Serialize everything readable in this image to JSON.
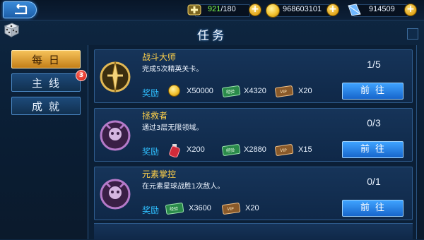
{
  "header": {
    "stamina": {
      "current": "921",
      "max": "/180",
      "icon": "stamina-plus-icon"
    },
    "gold": {
      "value": "968603101",
      "icon": "gold-coin-icon"
    },
    "diamond": {
      "value": "914509",
      "icon": "blue-crystal-icon"
    },
    "plus": "+"
  },
  "title": "任务",
  "tabs": [
    {
      "label": "每日",
      "active": true
    },
    {
      "label": "主线",
      "badge": "3"
    },
    {
      "label": "成就"
    }
  ],
  "tasks": [
    {
      "name": "战斗大师",
      "desc": "完成5次精英关卡。",
      "progress": "1/5",
      "reward_label": "奖励",
      "rewards": [
        {
          "icon": "gold-coin-icon",
          "qty": "X50000"
        },
        {
          "icon": "exp-ticket-icon",
          "qty": "X4320"
        },
        {
          "icon": "vip-ticket-icon",
          "qty": "X20"
        }
      ],
      "button": "前往",
      "emblem_color": "#c49a3a"
    },
    {
      "name": "拯救者",
      "desc": "通过3层无限领域。",
      "progress": "0/3",
      "reward_label": "奖励",
      "rewards": [
        {
          "icon": "red-potion-icon",
          "qty": "X200"
        },
        {
          "icon": "exp-ticket-icon",
          "qty": "X2880"
        },
        {
          "icon": "vip-ticket-icon",
          "qty": "X15"
        }
      ],
      "button": "前往",
      "emblem_color": "#8e4a9e"
    },
    {
      "name": "元素掌控",
      "desc": "在元素星球战胜1次敌人。",
      "progress": "0/1",
      "reward_label": "奖励",
      "rewards": [
        {
          "icon": "exp-ticket-icon",
          "qty": "X3600"
        },
        {
          "icon": "vip-ticket-icon",
          "qty": "X20"
        }
      ],
      "button": "前往",
      "emblem_color": "#8e4a9e"
    }
  ],
  "exp_ticket_text": "经验",
  "vip_ticket_text": "VIP"
}
